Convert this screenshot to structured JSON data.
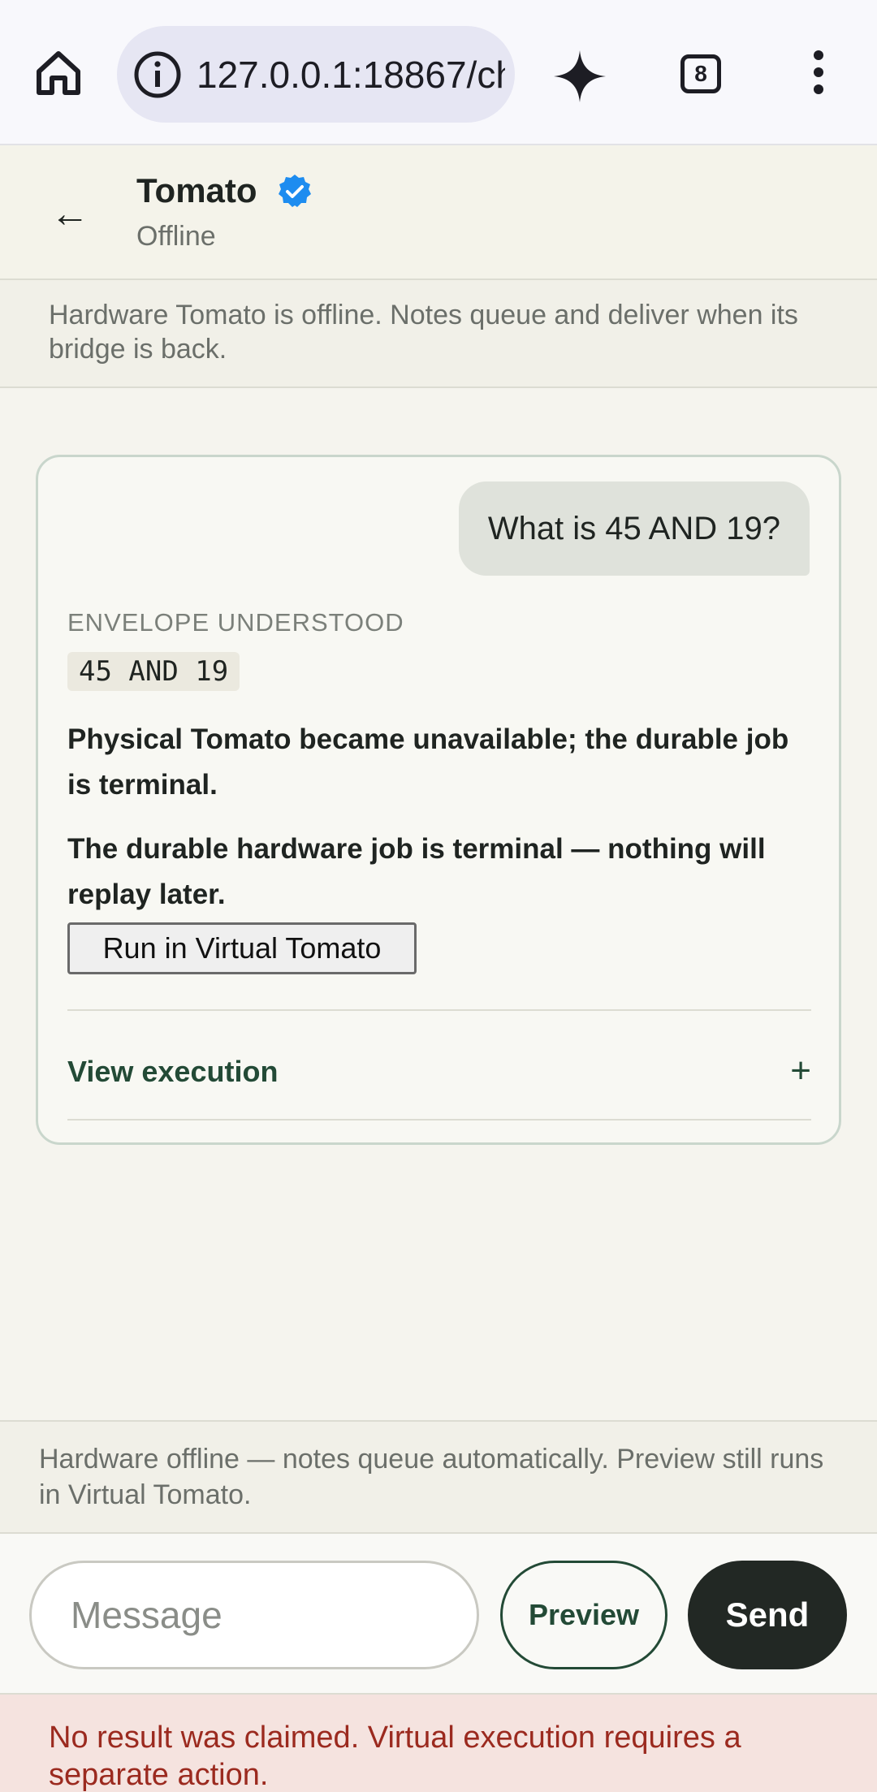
{
  "browser": {
    "url": "127.0.0.1:18867/ch",
    "tab_count": "8",
    "icons": [
      "home-icon",
      "info-icon",
      "sparkle-icon",
      "tabs-icon",
      "more-vert-icon"
    ]
  },
  "header": {
    "back_label": "←",
    "name": "Tomato",
    "status": "Offline",
    "verified_icon": "verified-badge-icon",
    "verified_color": "#1d8cf0"
  },
  "offline_banner": "Hardware Tomato is offline. Notes queue and deliver when its bridge is back.",
  "conversation": {
    "user_message": "What is 45 AND 19?",
    "envelope_label": "ENVELOPE UNDERSTOOD",
    "envelope_expression": "45 AND 19",
    "status_primary": "Physical Tomato became unavailable; the durable job is terminal.",
    "status_secondary": "The durable hardware job is terminal — nothing will replay later.",
    "run_virtual_label": "Run in Virtual Tomato",
    "view_execution_label": "View execution",
    "expand_symbol": "+"
  },
  "footer_note": "Hardware offline — notes queue automatically. Preview still runs in Virtual Tomato.",
  "composer": {
    "placeholder": "Message",
    "value": "",
    "preview_label": "Preview",
    "send_label": "Send"
  },
  "error_banner": "No result was claimed. Virtual execution requires a separate action.",
  "colors": {
    "accent": "#234a36",
    "send_bg": "#222824",
    "error_text": "#9b2a1f",
    "error_bg": "#f5e3df",
    "page_bg": "#f5f4ee"
  }
}
